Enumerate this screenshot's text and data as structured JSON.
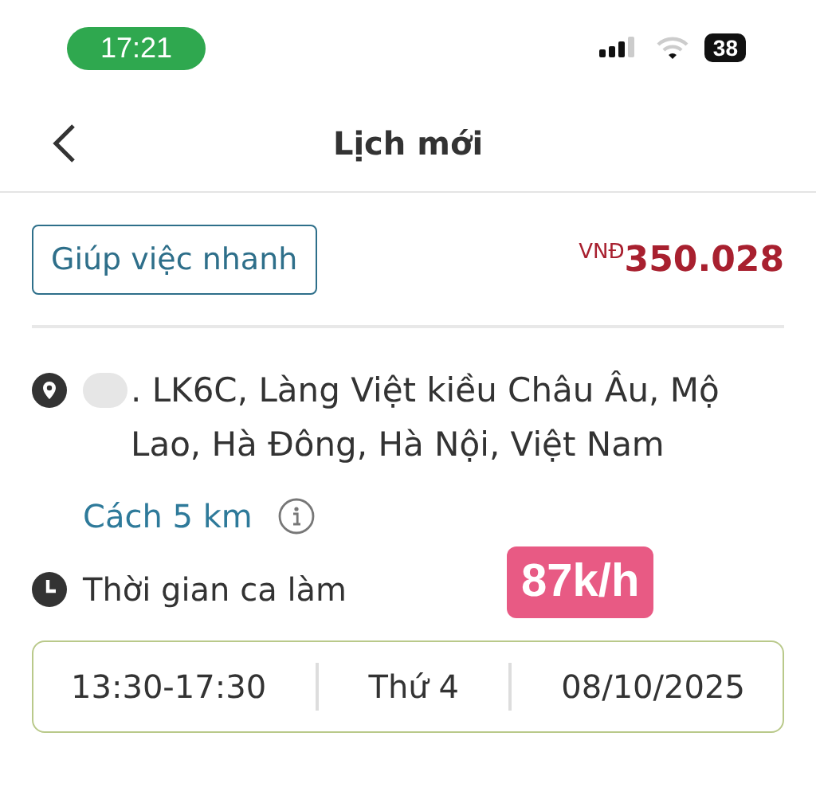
{
  "status_bar": {
    "time": "17:21",
    "battery": "38"
  },
  "header": {
    "title": "Lịch mới"
  },
  "service": {
    "tag": "Giúp việc nhanh",
    "currency": "VNĐ",
    "price": "350.028"
  },
  "address": {
    "text": ". LK6C, Làng Việt kiều Châu Âu, Mộ Lao, Hà Đông, Hà Nội, Việt Nam",
    "distance": "Cách 5 km"
  },
  "rate_badge": "87k/h",
  "shift": {
    "label": "Thời gian ca làm",
    "time": "13:30-17:30",
    "weekday": "Thứ 4",
    "date": "08/10/2025"
  }
}
